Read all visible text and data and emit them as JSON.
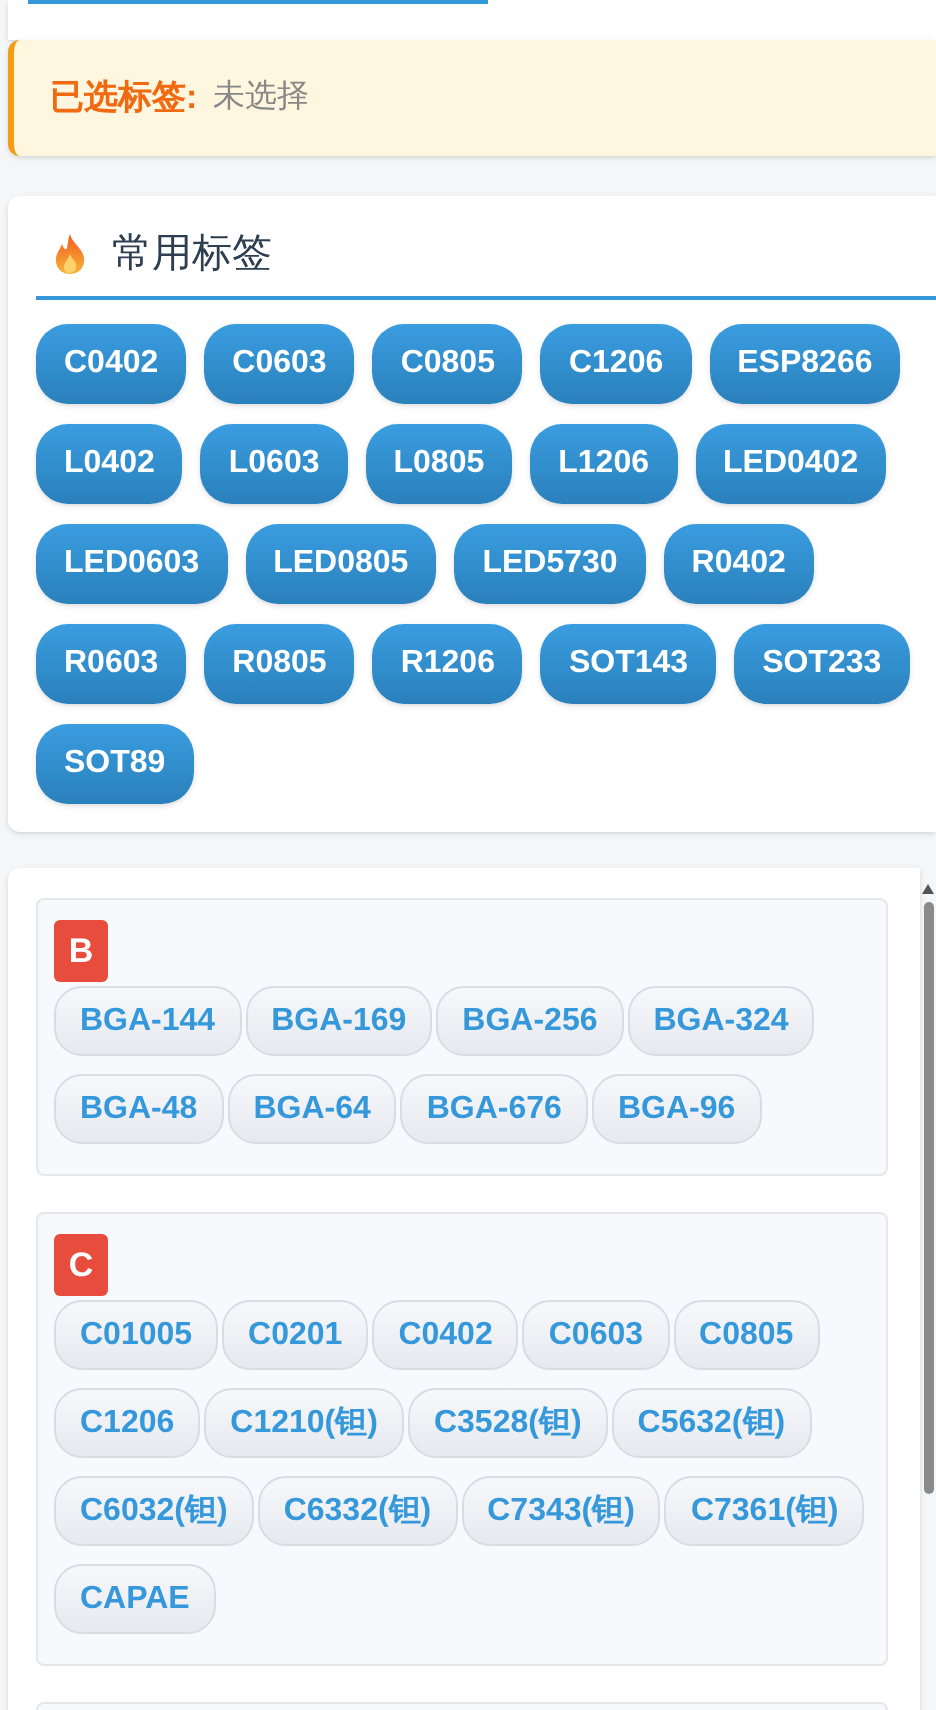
{
  "selected": {
    "label": "已选标签:",
    "value": "未选择"
  },
  "common_tags": {
    "title": "常用标签",
    "tags": [
      "C0402",
      "C0603",
      "C0805",
      "C1206",
      "ESP8266",
      "L0402",
      "L0603",
      "L0805",
      "L1206",
      "LED0402",
      "LED0603",
      "LED0805",
      "LED5730",
      "R0402",
      "R0603",
      "R0805",
      "R1206",
      "SOT143",
      "SOT233",
      "SOT89"
    ]
  },
  "groups": [
    {
      "letter": "B",
      "tags": [
        "BGA-144",
        "BGA-169",
        "BGA-256",
        "BGA-324",
        "BGA-48",
        "BGA-64",
        "BGA-676",
        "BGA-96"
      ]
    },
    {
      "letter": "C",
      "tags": [
        "C01005",
        "C0201",
        "C0402",
        "C0603",
        "C0805",
        "C1206",
        "C1210(钽)",
        "C3528(钽)",
        "C5632(钽)",
        "C6032(钽)",
        "C6332(钽)",
        "C7343(钽)",
        "C7361(钽)",
        "CAPAE"
      ]
    }
  ]
}
